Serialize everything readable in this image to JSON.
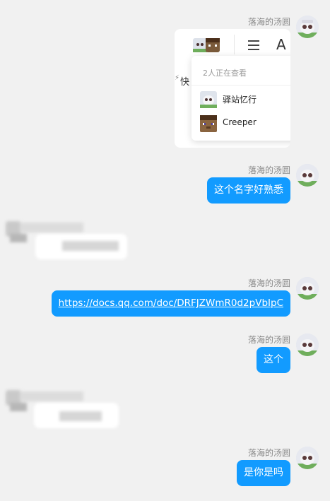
{
  "messages": [
    {
      "sender": "落海的汤圆",
      "type": "image"
    },
    {
      "sender": "落海的汤圆",
      "text": "这个名字好熟悉"
    },
    {
      "sender": "落海的汤圆",
      "text": "https://docs.qq.com/doc/DRFJZWmR0d2pVbIpC"
    },
    {
      "sender": "落海的汤圆",
      "text": "这个"
    },
    {
      "sender": "落海的汤圆",
      "text": "是你是吗"
    }
  ],
  "screenshot": {
    "toolbar_text": "快",
    "menu_icon": "hamburger-icon",
    "text_icon": "A",
    "viewers_title": "2人正在查看",
    "viewers": [
      {
        "name": "驿站忆行",
        "avatar": "anime-avatar"
      },
      {
        "name": "Creeper",
        "avatar": "creeper-avatar"
      }
    ]
  },
  "colors": {
    "bubble": "#129bff",
    "background": "#f1f1f1"
  }
}
